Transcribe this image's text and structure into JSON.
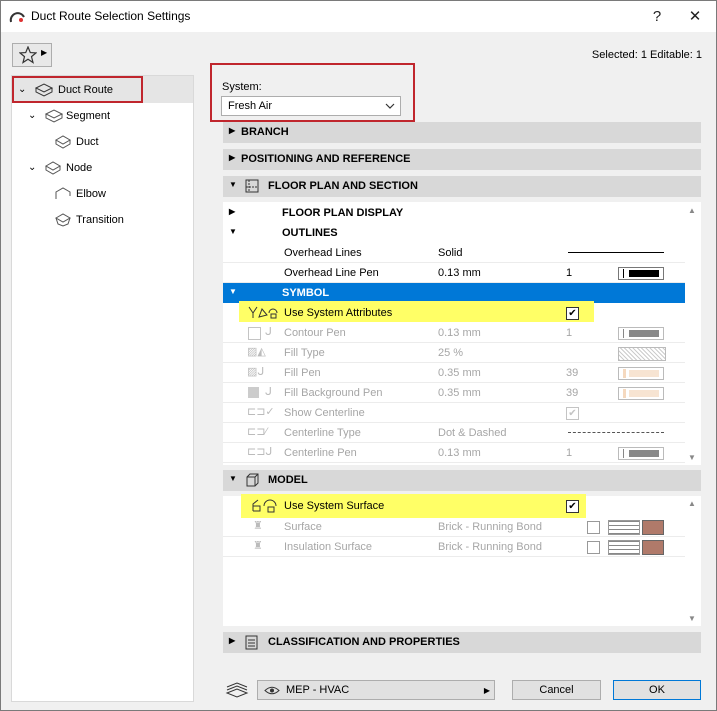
{
  "window": {
    "title": "Duct Route Selection Settings",
    "help": "?",
    "close": "✕"
  },
  "header": {
    "selected_info": "Selected: 1 Editable: 1"
  },
  "tree": {
    "items": [
      {
        "label": "Duct Route"
      },
      {
        "label": "Segment"
      },
      {
        "label": "Duct"
      },
      {
        "label": "Node"
      },
      {
        "label": "Elbow"
      },
      {
        "label": "Transition"
      }
    ]
  },
  "system": {
    "label": "System:",
    "value": "Fresh Air"
  },
  "panels": {
    "branch": "BRANCH",
    "positioning": "POSITIONING AND REFERENCE",
    "floor_plan": "FLOOR PLAN AND SECTION",
    "model": "MODEL",
    "classification": "CLASSIFICATION AND PROPERTIES"
  },
  "floor_plan": {
    "subgroups": {
      "display": "FLOOR PLAN DISPLAY",
      "outlines": "OUTLINES",
      "symbol": "SYMBOL"
    },
    "outline_rows": [
      {
        "name": "Overhead Lines",
        "value": "Solid",
        "num": ""
      },
      {
        "name": "Overhead Line Pen",
        "value": "0.13 mm",
        "num": "1"
      }
    ],
    "use_system_attributes": "Use System Attributes",
    "symbol_rows": [
      {
        "name": "Contour Pen",
        "value": "0.13 mm",
        "num": "1"
      },
      {
        "name": "Fill Type",
        "value": "25 %",
        "num": ""
      },
      {
        "name": "Fill Pen",
        "value": "0.35 mm",
        "num": "39"
      },
      {
        "name": "Fill Background Pen",
        "value": "0.35 mm",
        "num": "39"
      },
      {
        "name": "Show Centerline",
        "value": "",
        "num": ""
      },
      {
        "name": "Centerline Type",
        "value": "Dot & Dashed",
        "num": ""
      },
      {
        "name": "Centerline Pen",
        "value": "0.13 mm",
        "num": "1"
      }
    ]
  },
  "model": {
    "use_system_surface": "Use System Surface",
    "rows": [
      {
        "name": "Surface",
        "value": "Brick - Running Bond"
      },
      {
        "name": "Insulation Surface",
        "value": "Brick - Running Bond"
      }
    ]
  },
  "footer": {
    "layer": "MEP - HVAC",
    "cancel": "Cancel",
    "ok": "OK"
  },
  "colors": {
    "accent": "#0078d7",
    "highlight": "#ffff66",
    "callout": "#c0262d"
  }
}
